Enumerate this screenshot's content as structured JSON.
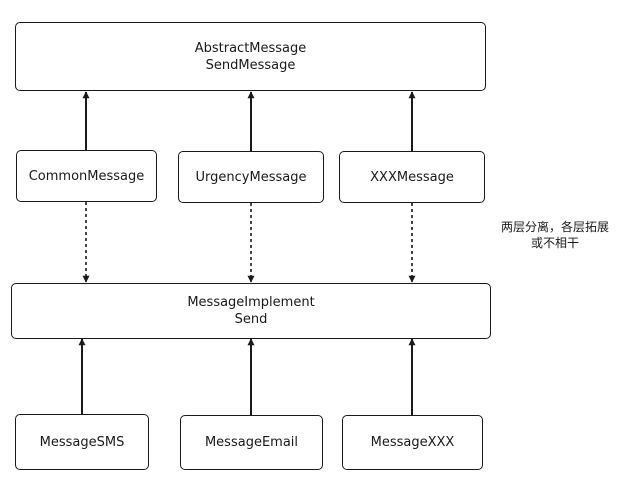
{
  "abstract": {
    "line1": "AbstractMessage",
    "line2": "SendMessage"
  },
  "refined": [
    "CommonMessage",
    "UrgencyMessage",
    "XXXMessage"
  ],
  "implementor": {
    "line1": "MessageImplement",
    "line2": "Send"
  },
  "concrete": [
    "MessageSMS",
    "MessageEmail",
    "MessageXXX"
  ],
  "note": {
    "line1": "两层分离，各层拓展",
    "line2": "或不相干"
  },
  "colors": {
    "stroke": "#1a1a1a",
    "background": "#ffffff"
  }
}
